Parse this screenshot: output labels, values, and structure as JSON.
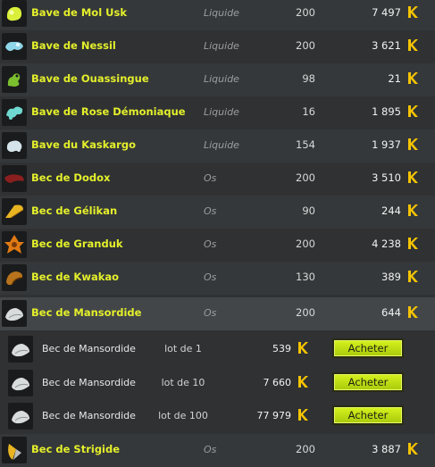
{
  "colors": {
    "name": "#e4f02b",
    "kama": "#f5c400",
    "button": "#c8e614"
  },
  "rows": [
    {
      "name": "Bave de Mol Usk",
      "type": "Liquide",
      "level": "200",
      "price": "7 497",
      "icon": "slime-yellow-icon"
    },
    {
      "name": "Bave de Nessil",
      "type": "Liquide",
      "level": "200",
      "price": "3 621",
      "icon": "slime-blue-icon"
    },
    {
      "name": "Bave de Ouassingue",
      "type": "Liquide",
      "level": "98",
      "price": "21",
      "icon": "slime-green-icon"
    },
    {
      "name": "Bave de Rose Démoniaque",
      "type": "Liquide",
      "level": "16",
      "price": "1 895",
      "icon": "slime-cyan-icon"
    },
    {
      "name": "Bave du Kaskargo",
      "type": "Liquide",
      "level": "154",
      "price": "1 937",
      "icon": "slime-white-icon"
    },
    {
      "name": "Bec de Dodox",
      "type": "Os",
      "level": "200",
      "price": "3 510",
      "icon": "beak-red-icon"
    },
    {
      "name": "Bec de Gélikan",
      "type": "Os",
      "level": "90",
      "price": "244",
      "icon": "beak-yellow-icon"
    },
    {
      "name": "Bec de Granduk",
      "type": "Os",
      "level": "200",
      "price": "4 238",
      "icon": "beak-orange-icon"
    },
    {
      "name": "Bec de Kwakao",
      "type": "Os",
      "level": "130",
      "price": "389",
      "icon": "beak-brown-icon"
    },
    {
      "name": "Bec de Mansordide",
      "type": "Os",
      "level": "200",
      "price": "644",
      "icon": "beak-white-icon"
    }
  ],
  "lots": [
    {
      "name": "Bec de Mansordide",
      "lot": "lot de 1",
      "price": "539",
      "button": "Acheter"
    },
    {
      "name": "Bec de Mansordide",
      "lot": "lot de 10",
      "price": "7 660",
      "button": "Acheter"
    },
    {
      "name": "Bec de Mansordide",
      "lot": "lot de 100",
      "price": "77 979",
      "button": "Acheter"
    }
  ],
  "last_row": {
    "name": "Bec de Strigide",
    "type": "Os",
    "level": "200",
    "price": "3 887",
    "icon": "beak-strigide-icon"
  }
}
